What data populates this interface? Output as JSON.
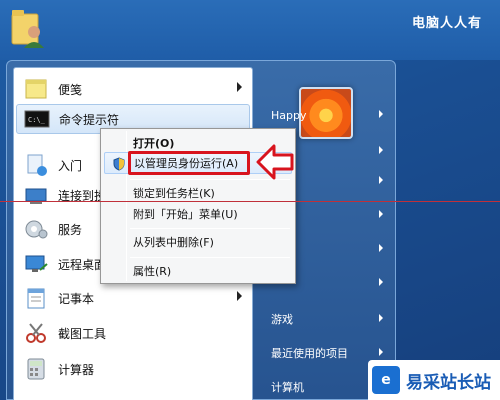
{
  "desktop": {
    "watermark": "电脑人人有",
    "brand": "易采站长站"
  },
  "start_menu": {
    "programs": [
      {
        "label": "便笺",
        "icon": "sticky-notes-icon",
        "has_submenu": true
      },
      {
        "label": "命令提示符",
        "icon": "command-prompt-icon",
        "has_submenu": false,
        "active": true
      },
      {
        "label": "入门",
        "icon": "getting-started-icon",
        "has_submenu": false
      },
      {
        "label": "连接到投影",
        "icon": "projector-icon",
        "has_submenu": false
      },
      {
        "label": "服务",
        "icon": "services-icon",
        "has_submenu": false
      },
      {
        "label": "远程桌面连",
        "icon": "remote-desktop-icon",
        "has_submenu": false
      },
      {
        "label": "记事本",
        "icon": "notepad-icon",
        "has_submenu": true
      },
      {
        "label": "截图工具",
        "icon": "snipping-tool-icon",
        "has_submenu": false
      },
      {
        "label": "计算器",
        "icon": "calculator-icon",
        "has_submenu": false
      }
    ],
    "right_items": [
      {
        "label": "Happy",
        "has_submenu": true
      },
      {
        "label": "",
        "has_submenu": true
      },
      {
        "label": "",
        "has_submenu": true
      },
      {
        "label": "",
        "has_submenu": true
      },
      {
        "label": "",
        "has_submenu": true
      },
      {
        "label": "",
        "has_submenu": true
      },
      {
        "label": "游戏",
        "has_submenu": true
      },
      {
        "label": "最近使用的项目",
        "has_submenu": true
      },
      {
        "label": "计算机",
        "has_submenu": false
      }
    ]
  },
  "context_menu": {
    "items": [
      {
        "label": "打开(O)",
        "bold": true
      },
      {
        "label": "以管理员身份运行(A)",
        "highlight": true
      },
      {
        "label": "锁定到任务栏(K)"
      },
      {
        "label": "附到「开始」菜单(U)"
      },
      {
        "label": "从列表中删除(F)"
      },
      {
        "label": "属性(R)"
      }
    ]
  },
  "colors": {
    "annotation_red": "#d8141e",
    "desktop_blue": "#1f5fa8"
  }
}
